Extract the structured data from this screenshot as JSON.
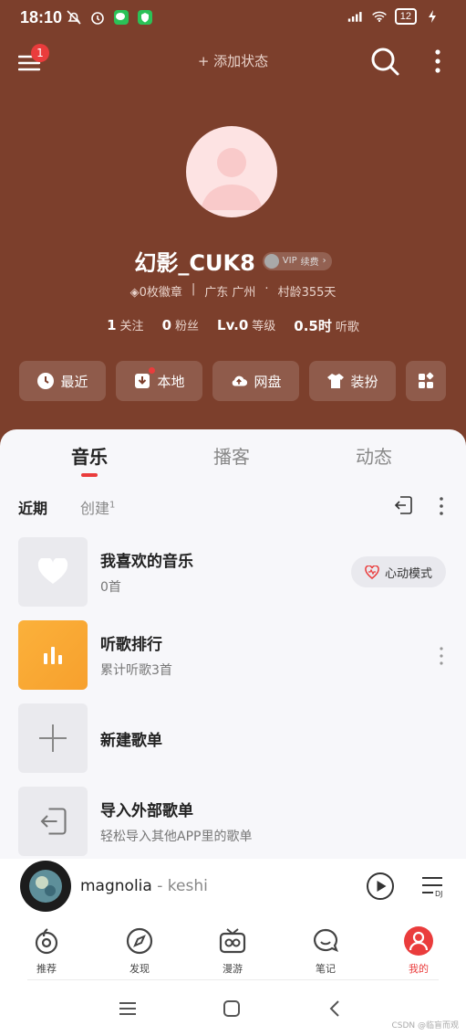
{
  "status_bar": {
    "time": "18:10",
    "battery": "12"
  },
  "header": {
    "menu_badge": "1",
    "add_status": "+ 添加状态"
  },
  "profile": {
    "username": "幻影_CUK8",
    "vip_label": "VIP",
    "vip_action": "续费",
    "badges": "0枚徽章",
    "location": "广东 广州",
    "village_age": "村龄355天",
    "stats": [
      {
        "value": "1",
        "label": "关注"
      },
      {
        "value": "0",
        "label": "粉丝"
      },
      {
        "value": "Lv.0",
        "label": "等级"
      },
      {
        "value": "0.5时",
        "label": "听歌"
      }
    ]
  },
  "quick_actions": [
    {
      "label": "最近",
      "icon": "clock-icon"
    },
    {
      "label": "本地",
      "icon": "download-icon"
    },
    {
      "label": "网盘",
      "icon": "cloud-upload-icon"
    },
    {
      "label": "装扮",
      "icon": "shirt-icon"
    },
    {
      "label": "",
      "icon": "grid-icon"
    }
  ],
  "tabs": [
    {
      "label": "音乐",
      "active": true
    },
    {
      "label": "播客",
      "active": false
    },
    {
      "label": "动态",
      "active": false
    }
  ],
  "subtabs": {
    "recent": "近期",
    "created": "创建",
    "created_count": "1"
  },
  "playlists": [
    {
      "title": "我喜欢的音乐",
      "subtitle": "0首",
      "action": "心动模式"
    },
    {
      "title": "听歌排行",
      "subtitle": "累计听歌3首"
    },
    {
      "title": "新建歌单",
      "subtitle": ""
    },
    {
      "title": "导入外部歌单",
      "subtitle": "轻松导入其他APP里的歌单"
    }
  ],
  "player": {
    "song": "magnolia",
    "separator": " - ",
    "artist": "keshi"
  },
  "bottom_nav": [
    {
      "label": "推荐",
      "icon": "recommend-icon"
    },
    {
      "label": "发现",
      "icon": "compass-icon"
    },
    {
      "label": "漫游",
      "icon": "radio-icon"
    },
    {
      "label": "笔记",
      "icon": "chat-icon"
    },
    {
      "label": "我的",
      "icon": "user-icon",
      "active": true
    }
  ],
  "watermark": "CSDN @临盲而观",
  "colors": {
    "hero_bg": "#7c3f2c",
    "accent_red": "#ea3c3c",
    "rank_orange": "#fbb13b"
  }
}
